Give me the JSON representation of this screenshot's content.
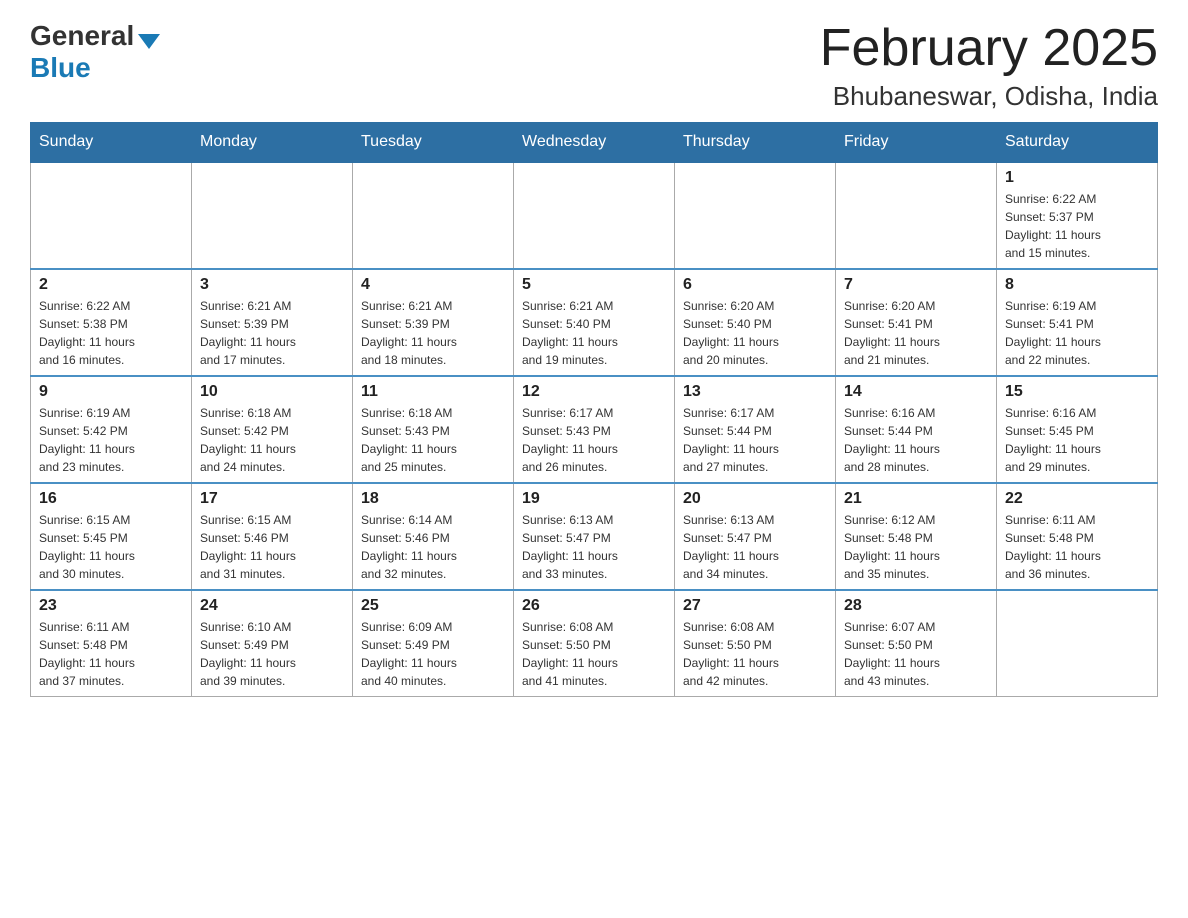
{
  "logo": {
    "general": "General",
    "blue": "Blue",
    "triangle": "▲"
  },
  "title": "February 2025",
  "subtitle": "Bhubaneswar, Odisha, India",
  "weekdays": [
    "Sunday",
    "Monday",
    "Tuesday",
    "Wednesday",
    "Thursday",
    "Friday",
    "Saturday"
  ],
  "weeks": [
    [
      {
        "day": "",
        "info": ""
      },
      {
        "day": "",
        "info": ""
      },
      {
        "day": "",
        "info": ""
      },
      {
        "day": "",
        "info": ""
      },
      {
        "day": "",
        "info": ""
      },
      {
        "day": "",
        "info": ""
      },
      {
        "day": "1",
        "info": "Sunrise: 6:22 AM\nSunset: 5:37 PM\nDaylight: 11 hours\nand 15 minutes."
      }
    ],
    [
      {
        "day": "2",
        "info": "Sunrise: 6:22 AM\nSunset: 5:38 PM\nDaylight: 11 hours\nand 16 minutes."
      },
      {
        "day": "3",
        "info": "Sunrise: 6:21 AM\nSunset: 5:39 PM\nDaylight: 11 hours\nand 17 minutes."
      },
      {
        "day": "4",
        "info": "Sunrise: 6:21 AM\nSunset: 5:39 PM\nDaylight: 11 hours\nand 18 minutes."
      },
      {
        "day": "5",
        "info": "Sunrise: 6:21 AM\nSunset: 5:40 PM\nDaylight: 11 hours\nand 19 minutes."
      },
      {
        "day": "6",
        "info": "Sunrise: 6:20 AM\nSunset: 5:40 PM\nDaylight: 11 hours\nand 20 minutes."
      },
      {
        "day": "7",
        "info": "Sunrise: 6:20 AM\nSunset: 5:41 PM\nDaylight: 11 hours\nand 21 minutes."
      },
      {
        "day": "8",
        "info": "Sunrise: 6:19 AM\nSunset: 5:41 PM\nDaylight: 11 hours\nand 22 minutes."
      }
    ],
    [
      {
        "day": "9",
        "info": "Sunrise: 6:19 AM\nSunset: 5:42 PM\nDaylight: 11 hours\nand 23 minutes."
      },
      {
        "day": "10",
        "info": "Sunrise: 6:18 AM\nSunset: 5:42 PM\nDaylight: 11 hours\nand 24 minutes."
      },
      {
        "day": "11",
        "info": "Sunrise: 6:18 AM\nSunset: 5:43 PM\nDaylight: 11 hours\nand 25 minutes."
      },
      {
        "day": "12",
        "info": "Sunrise: 6:17 AM\nSunset: 5:43 PM\nDaylight: 11 hours\nand 26 minutes."
      },
      {
        "day": "13",
        "info": "Sunrise: 6:17 AM\nSunset: 5:44 PM\nDaylight: 11 hours\nand 27 minutes."
      },
      {
        "day": "14",
        "info": "Sunrise: 6:16 AM\nSunset: 5:44 PM\nDaylight: 11 hours\nand 28 minutes."
      },
      {
        "day": "15",
        "info": "Sunrise: 6:16 AM\nSunset: 5:45 PM\nDaylight: 11 hours\nand 29 minutes."
      }
    ],
    [
      {
        "day": "16",
        "info": "Sunrise: 6:15 AM\nSunset: 5:45 PM\nDaylight: 11 hours\nand 30 minutes."
      },
      {
        "day": "17",
        "info": "Sunrise: 6:15 AM\nSunset: 5:46 PM\nDaylight: 11 hours\nand 31 minutes."
      },
      {
        "day": "18",
        "info": "Sunrise: 6:14 AM\nSunset: 5:46 PM\nDaylight: 11 hours\nand 32 minutes."
      },
      {
        "day": "19",
        "info": "Sunrise: 6:13 AM\nSunset: 5:47 PM\nDaylight: 11 hours\nand 33 minutes."
      },
      {
        "day": "20",
        "info": "Sunrise: 6:13 AM\nSunset: 5:47 PM\nDaylight: 11 hours\nand 34 minutes."
      },
      {
        "day": "21",
        "info": "Sunrise: 6:12 AM\nSunset: 5:48 PM\nDaylight: 11 hours\nand 35 minutes."
      },
      {
        "day": "22",
        "info": "Sunrise: 6:11 AM\nSunset: 5:48 PM\nDaylight: 11 hours\nand 36 minutes."
      }
    ],
    [
      {
        "day": "23",
        "info": "Sunrise: 6:11 AM\nSunset: 5:48 PM\nDaylight: 11 hours\nand 37 minutes."
      },
      {
        "day": "24",
        "info": "Sunrise: 6:10 AM\nSunset: 5:49 PM\nDaylight: 11 hours\nand 39 minutes."
      },
      {
        "day": "25",
        "info": "Sunrise: 6:09 AM\nSunset: 5:49 PM\nDaylight: 11 hours\nand 40 minutes."
      },
      {
        "day": "26",
        "info": "Sunrise: 6:08 AM\nSunset: 5:50 PM\nDaylight: 11 hours\nand 41 minutes."
      },
      {
        "day": "27",
        "info": "Sunrise: 6:08 AM\nSunset: 5:50 PM\nDaylight: 11 hours\nand 42 minutes."
      },
      {
        "day": "28",
        "info": "Sunrise: 6:07 AM\nSunset: 5:50 PM\nDaylight: 11 hours\nand 43 minutes."
      },
      {
        "day": "",
        "info": ""
      }
    ]
  ]
}
